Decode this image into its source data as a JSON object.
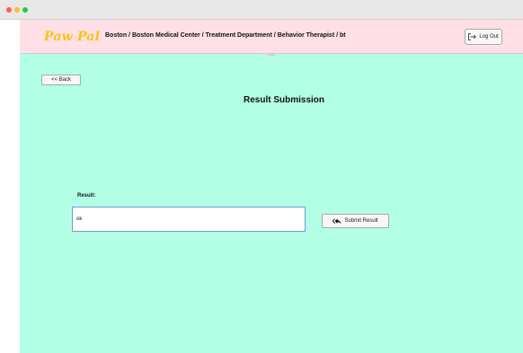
{
  "header": {
    "logo": "Paw Pal",
    "breadcrumb": "Boston / Boston Medical Center / Treatment Department / Behavior Therapist / bt",
    "logout_label": "Log Out"
  },
  "main": {
    "back_label": "<< Back",
    "title": "Result Submission",
    "result_label": "Result:",
    "result_value": "ok",
    "submit_label": "Submit Result"
  },
  "colors": {
    "background": "#b3ffe6",
    "header_background": "#ffe0e6",
    "logo": "#f5c518"
  },
  "icons": {
    "logout": "logout-icon",
    "submit": "reply-all-icon"
  }
}
